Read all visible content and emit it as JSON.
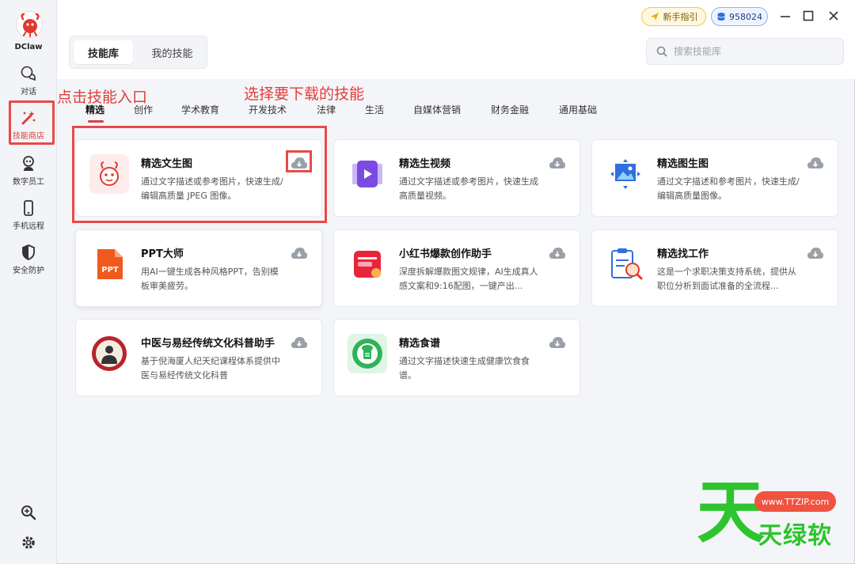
{
  "app": {
    "name": "DClaw"
  },
  "sidebar": {
    "items": [
      {
        "label": "对话",
        "icon": "chat-icon"
      },
      {
        "label": "技能商店",
        "icon": "magic-wand-icon",
        "active": true
      },
      {
        "label": "数字员工",
        "icon": "robot-icon"
      },
      {
        "label": "手机远程",
        "icon": "phone-icon"
      },
      {
        "label": "安全防护",
        "icon": "shield-icon"
      }
    ],
    "bottom": [
      {
        "icon": "zoom-icon"
      },
      {
        "icon": "gear-icon"
      }
    ]
  },
  "header": {
    "guide_label": "新手指引",
    "credits": "958024",
    "tabs": [
      {
        "label": "技能库",
        "active": true
      },
      {
        "label": "我的技能"
      }
    ],
    "search_placeholder": "搜索技能库"
  },
  "annotations": {
    "sidebar_tip": "点击技能入口",
    "skill_tip": "选择要下载的技能"
  },
  "categories": [
    "精选",
    "创作",
    "学术教育",
    "开发技术",
    "法律",
    "生活",
    "自媒体营销",
    "财务金融",
    "通用基础"
  ],
  "skills": [
    {
      "title": "精选文生图",
      "desc": "通过文字描述或参考图片，快速生成/编辑高质量 JPEG 图像。"
    },
    {
      "title": "精选生视频",
      "desc": "通过文字描述或参考图片，快速生成高质量视频。"
    },
    {
      "title": "精选图生图",
      "desc": "通过文字描述和参考图片，快速生成/编辑高质量图像。"
    },
    {
      "title": "PPT大师",
      "desc": "用AI一键生成各种风格PPT，告别模板审美疲劳。"
    },
    {
      "title": "小红书爆款创作助手",
      "desc": "深度拆解爆款图文规律，AI生成真人感文案和9:16配图，一键产出..."
    },
    {
      "title": "精选找工作",
      "desc": "这是一个求职决策支持系统，提供从职位分析到面试准备的全流程..."
    },
    {
      "title": "中医与易经传统文化科普助手",
      "desc": "基于倪海厦人纪天纪课程体系提供中医与易经传统文化科普"
    },
    {
      "title": "精选食谱",
      "desc": "通过文字描述快速生成健康饮食食谱。"
    }
  ],
  "watermark": {
    "big": "天",
    "url": "www.TTZIP.com",
    "text": "天绿软"
  },
  "colors": {
    "accent": "#e23c3c",
    "annotation": "#e84a4a",
    "watermark_green": "#2ec42e"
  }
}
